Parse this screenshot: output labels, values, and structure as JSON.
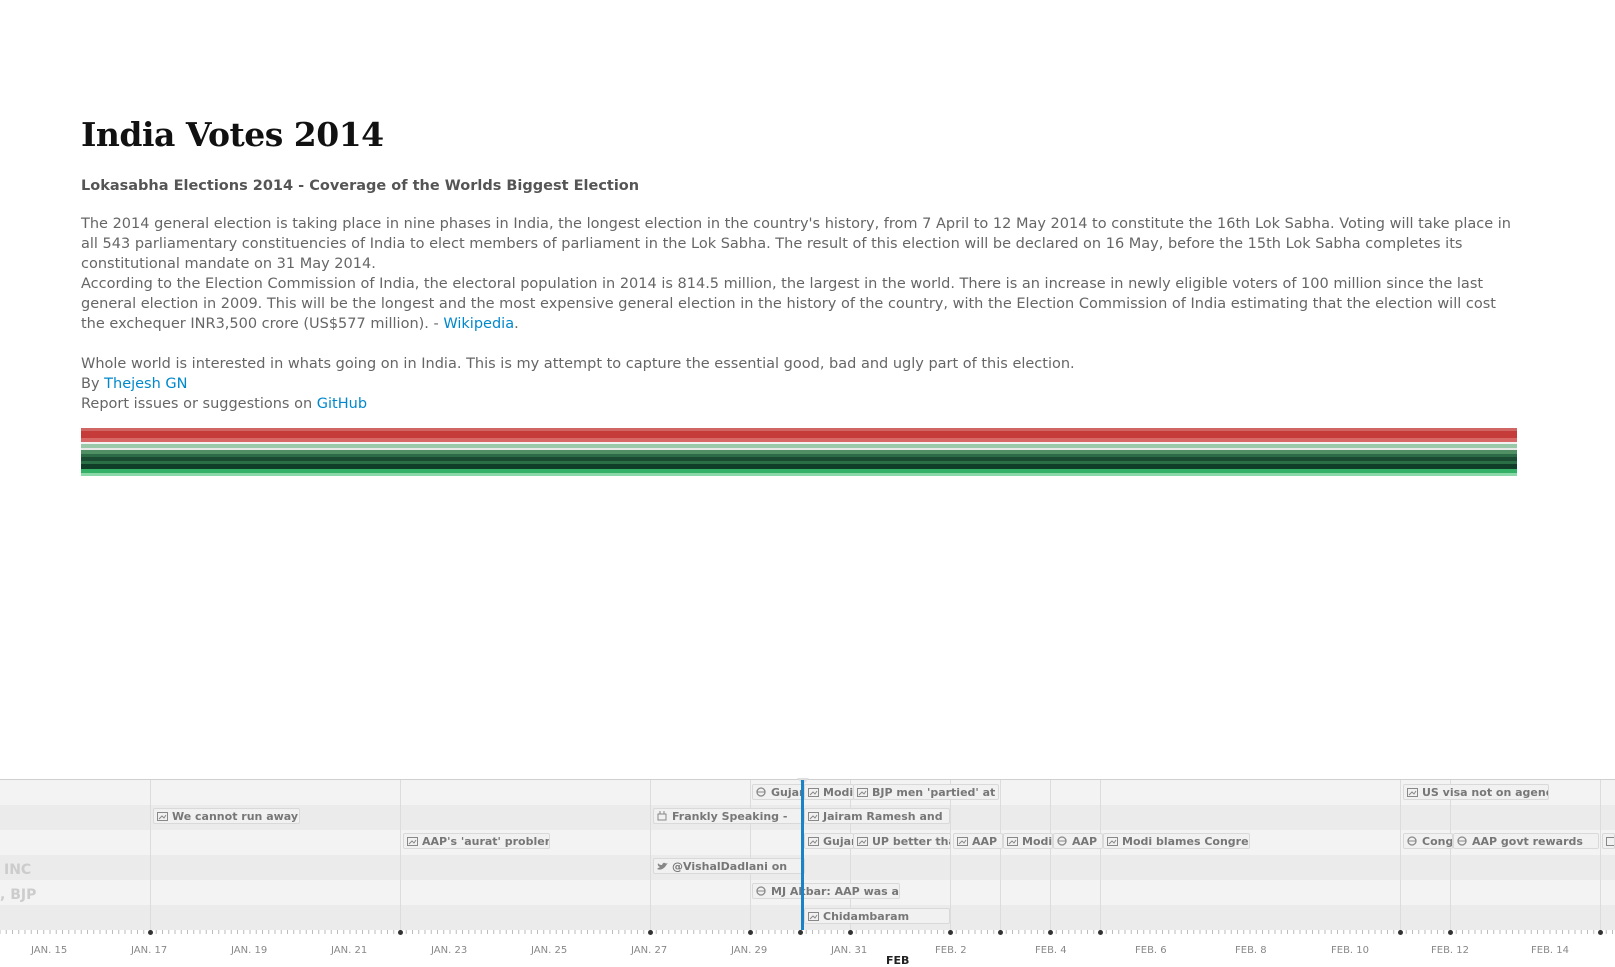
{
  "page": {
    "title": "India Votes 2014",
    "subtitle": "Lokasabha Elections 2014 - Coverage of the Worlds Biggest Election",
    "para1": "The 2014 general election is taking place in nine phases in India, the longest election in the country's history, from 7 April to 12 May 2014 to constitute the 16th Lok Sabha. Voting will take place in all 543 parliamentary constituencies of India to elect members of parliament in the Lok Sabha. The result of this election will be declared on 16 May, before the 15th Lok Sabha completes its constitutional mandate on 31 May 2014.",
    "para2_text": "According to the Election Commission of India, the electoral population in 2014 is 814.5 million, the largest in the world. There is an increase in newly eligible voters of 100 million since the last general election in 2009. This will be the longest and the most expensive general election in the history of the country, with the Election Commission of India estimating that the election will cost the exchequer INR3,500 crore (US$577 million). - ",
    "wikipedia_link": "Wikipedia",
    "para2_end": ".",
    "para3": "Whole world is interested in whats going on in India. This is my attempt to capture the essential good, bad and ugly part of this election.",
    "by_label": "By ",
    "author_link": "Thejesh GN",
    "report_label": "Report issues or suggestions on ",
    "github_link": "GitHub"
  },
  "colors": {
    "link": "#0088cc",
    "marker": "#1a83c8",
    "stripe_red": "#c53b39",
    "stripe_green": "#1a4a31"
  },
  "timeline": {
    "group_labels": [
      "INC",
      ", BJP"
    ],
    "events": [
      {
        "text": "Gujar",
        "icon": "web-icon"
      },
      {
        "text": "Modi",
        "icon": "image-icon"
      },
      {
        "text": "BJP men 'partied' at",
        "icon": "image-icon"
      },
      {
        "text": "US visa not on agenda",
        "icon": "image-icon"
      },
      {
        "text": "We cannot run away",
        "icon": "image-icon"
      },
      {
        "text": "Frankly Speaking -",
        "icon": "youtube-icon"
      },
      {
        "text": "Jairam Ramesh and",
        "icon": "image-icon"
      },
      {
        "text": "AAP's 'aurat' problem:",
        "icon": "image-icon"
      },
      {
        "text": "Gujar",
        "icon": "image-icon"
      },
      {
        "text": "UP better tha",
        "icon": "image-icon"
      },
      {
        "text": "AAP",
        "icon": "image-icon"
      },
      {
        "text": "Modi",
        "icon": "image-icon"
      },
      {
        "text": "AAP",
        "icon": "web-icon"
      },
      {
        "text": "Modi blames Congress",
        "icon": "image-icon"
      },
      {
        "text": "Cong",
        "icon": "web-icon"
      },
      {
        "text": "AAP govt rewards",
        "icon": "web-icon"
      },
      {
        "text": "@VishalDadlani on",
        "icon": "twitter-icon"
      },
      {
        "text": "MJ Akbar: AAP was a",
        "icon": "web-icon"
      },
      {
        "text": "Chidambaram",
        "icon": "image-icon"
      }
    ],
    "axis_labels": [
      "JAN. 15",
      "JAN. 17",
      "JAN. 19",
      "JAN. 21",
      "JAN. 23",
      "JAN. 25",
      "JAN. 27",
      "JAN. 29",
      "JAN. 31",
      "FEB. 2",
      "FEB. 4",
      "FEB. 6",
      "FEB. 8",
      "FEB. 10",
      "FEB. 12",
      "FEB. 14"
    ],
    "month_label": "FEB"
  }
}
